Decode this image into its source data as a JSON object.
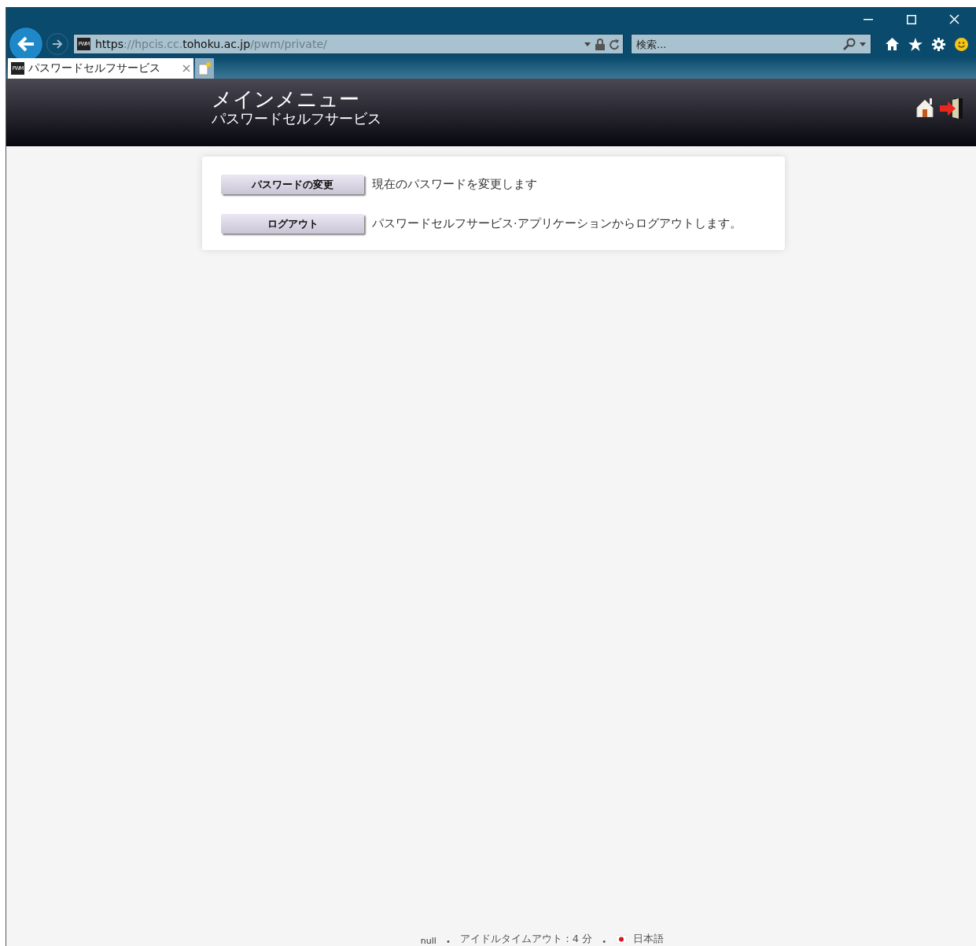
{
  "browser": {
    "url": "**https**://hpcis.cc.**tohoku.ac.jp**/pwm/private/",
    "favicon_text": "PWM",
    "search": {
      "placeholder": "検索..."
    },
    "tabs": [
      {
        "favicon_text": "PWM",
        "title": "パスワードセルフサービス",
        "selected": true
      }
    ]
  },
  "header": {
    "title": "メインメニュー",
    "subtitle": "パスワードセルフサービス"
  },
  "menu": [
    {
      "button": "パスワードの変更",
      "description": "現在のパスワードを変更します"
    },
    {
      "button": "ログアウト",
      "description": "パスワードセルフサービス·アプリケーションからログアウトします。"
    }
  ],
  "footer": [
    {
      "kind": "text",
      "text": "null"
    },
    {
      "kind": "separator",
      "text": "•"
    },
    {
      "kind": "text",
      "text": "アイドルタイムアウト：4 分"
    },
    {
      "kind": "separator",
      "text": "•"
    },
    {
      "kind": "language",
      "text": "日本語"
    }
  ]
}
